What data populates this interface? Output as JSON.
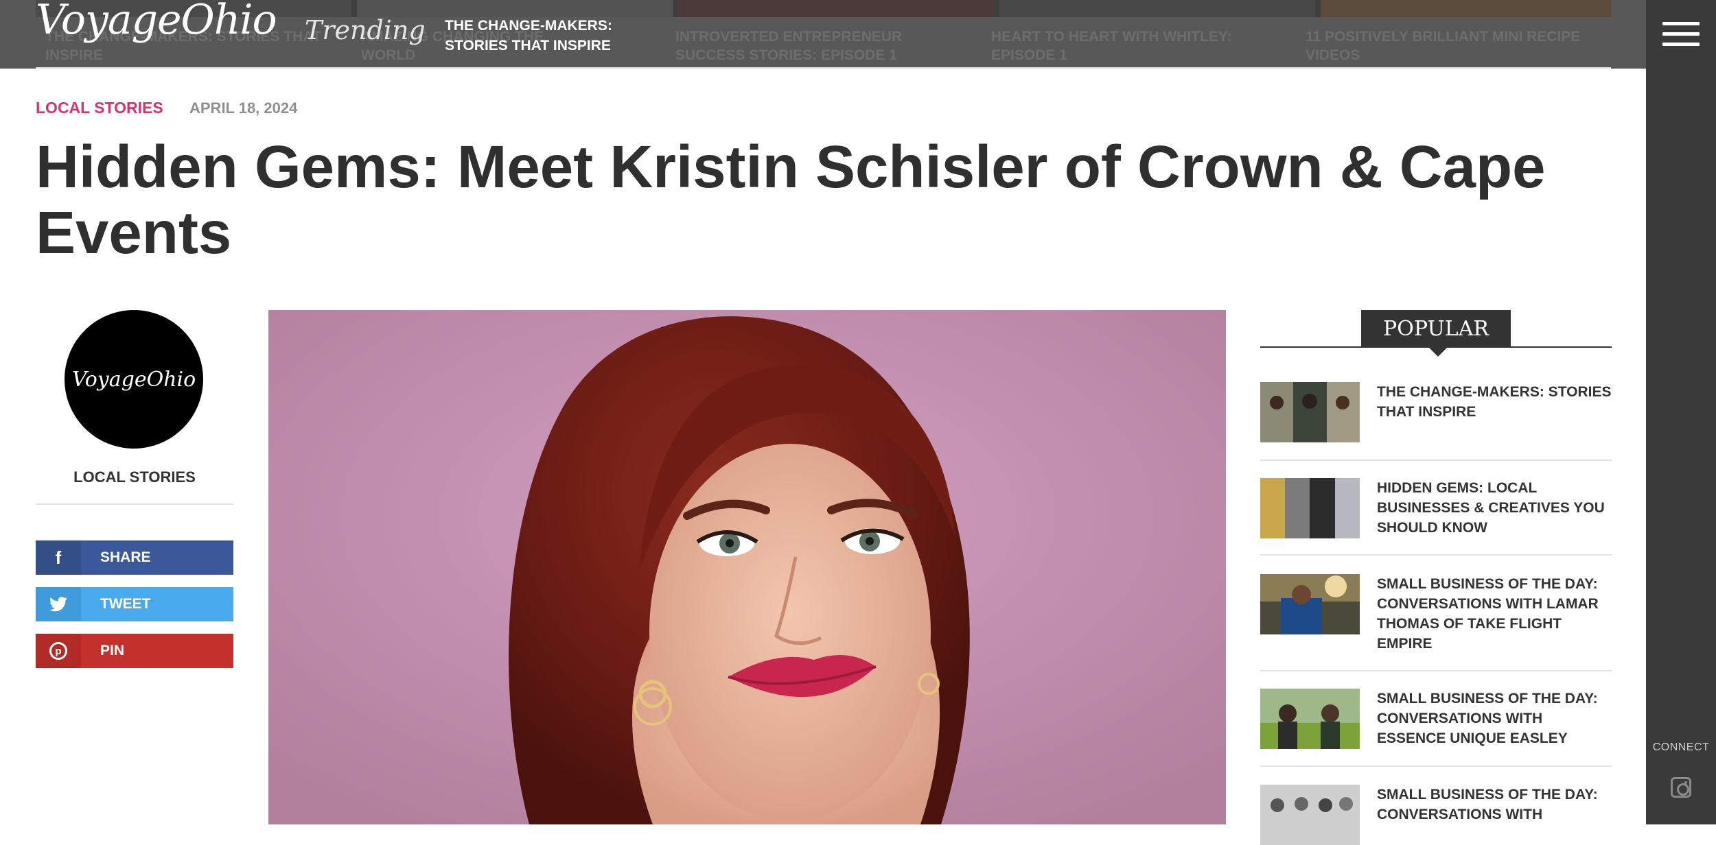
{
  "site": {
    "logo": "VoyageOhio"
  },
  "header": {
    "trending_label": "Trending",
    "trending_link": "THE CHANGE-MAKERS: STORIES THAT INSPIRE",
    "ghost_items": [
      "THE CHANGE-MAKERS: STORIES THAT INSPIRE",
      "AMAZING CHANGING THE WORLD",
      "INTROVERTED ENTREPRENEUR SUCCESS STORIES: EPISODE 1",
      "HEART TO HEART WITH WHITLEY: EPISODE 1",
      "11 POSITIVELY BRILLIANT MINI RECIPE VIDEOS"
    ]
  },
  "article": {
    "category": "LOCAL STORIES",
    "date": "APRIL 18, 2024",
    "title": "Hidden Gems: Meet Kristin Schisler of Crown & Cape Events"
  },
  "author_box": {
    "avatar_text": "VoyageOhio",
    "category": "LOCAL STORIES"
  },
  "share": {
    "facebook": {
      "icon": "facebook-icon",
      "label": "SHARE"
    },
    "twitter": {
      "icon": "twitter-icon",
      "label": "TWEET"
    },
    "pinterest": {
      "icon": "pinterest-icon",
      "label": "PIN"
    }
  },
  "popular": {
    "heading": "POPULAR",
    "items": [
      {
        "title": "THE CHANGE-MAKERS: STORIES THAT INSPIRE"
      },
      {
        "title": "HIDDEN GEMS: LOCAL BUSINESSES & CREATIVES YOU SHOULD KNOW"
      },
      {
        "title": "SMALL BUSINESS OF THE DAY: CONVERSATIONS WITH LAMAR THOMAS OF TAKE FLIGHT EMPIRE"
      },
      {
        "title": "SMALL BUSINESS OF THE DAY: CONVERSATIONS WITH ESSENCE UNIQUE EASLEY"
      },
      {
        "title": "SMALL BUSINESS OF THE DAY: CONVERSATIONS WITH"
      }
    ]
  },
  "side_rail": {
    "menu_icon": "hamburger-menu-icon",
    "connect_label": "CONNECT",
    "social_icon": "instagram-icon"
  },
  "colors": {
    "accent": "#d6336c",
    "header_bg": "#585858",
    "rail_bg": "#3a3a3a",
    "facebook": "#3b5998",
    "twitter": "#48aaed",
    "pinterest": "#c4302b"
  }
}
